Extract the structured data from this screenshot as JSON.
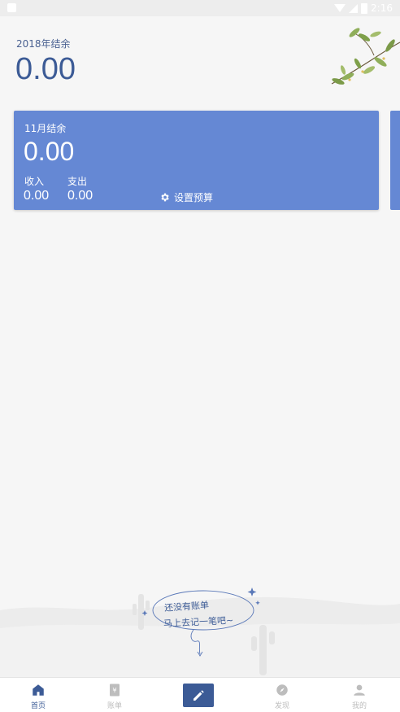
{
  "status_bar": {
    "time": "2:16"
  },
  "summary": {
    "year_label": "2018年结余",
    "year_value": "0.00"
  },
  "month_card": {
    "title": "11月结余",
    "balance": "0.00",
    "income_label": "收入",
    "income_value": "0.00",
    "expense_label": "支出",
    "expense_value": "0.00",
    "budget_label": "设置预算"
  },
  "empty_state": {
    "line1": "还没有账单",
    "line2": "马上去记一笔吧~"
  },
  "bottom_nav": {
    "items": [
      {
        "label": "首页",
        "icon": "home-icon",
        "active": true
      },
      {
        "label": "账单",
        "icon": "bill-icon",
        "active": false
      },
      {
        "label": "",
        "icon": "pencil-icon",
        "active": false
      },
      {
        "label": "发现",
        "icon": "compass-icon",
        "active": false
      },
      {
        "label": "我的",
        "icon": "person-icon",
        "active": false
      }
    ]
  },
  "colors": {
    "accent": "#3c5b96",
    "card": "#6588d4",
    "background": "#f6f6f6"
  }
}
